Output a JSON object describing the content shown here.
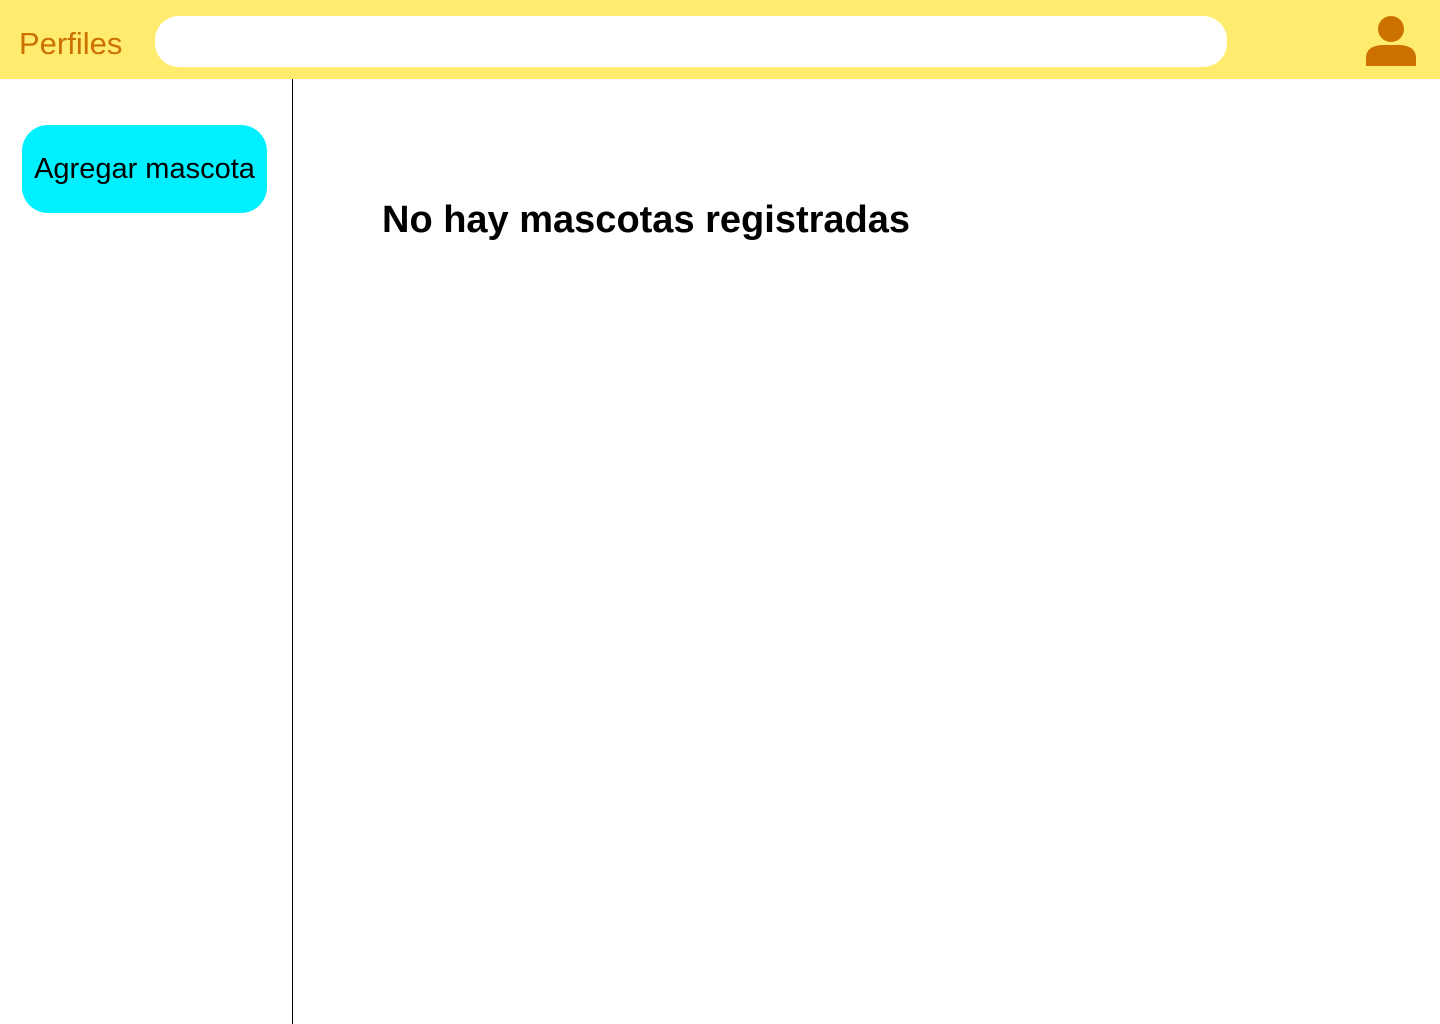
{
  "header": {
    "title": "Perfiles",
    "search": {
      "value": "",
      "placeholder": ""
    },
    "user_icon": "person-icon",
    "colors": {
      "bar": "#ffec6e",
      "accent": "#cc7000"
    }
  },
  "sidebar": {
    "add_pet_label": "Agregar mascota",
    "colors": {
      "button": "#00f0ff"
    }
  },
  "main": {
    "empty_message": "No hay mascotas registradas"
  }
}
